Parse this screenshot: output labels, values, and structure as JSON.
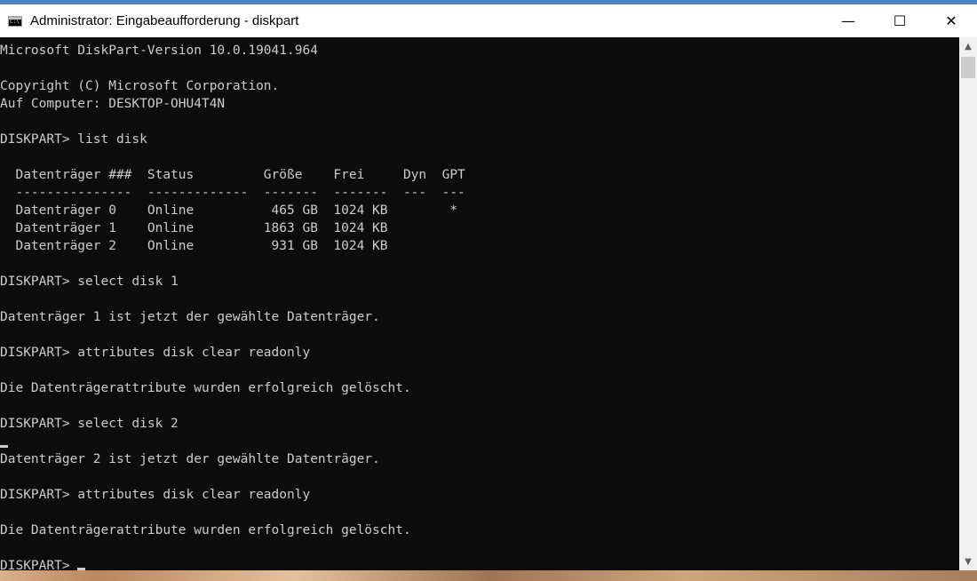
{
  "window": {
    "title": "Administrator: Eingabeaufforderung - diskpart",
    "minimize_symbol": "—",
    "maximize_symbol": "☐",
    "close_symbol": "✕"
  },
  "console": {
    "lines": [
      "Microsoft DiskPart-Version 10.0.19041.964",
      "",
      "Copyright (C) Microsoft Corporation.",
      "Auf Computer: DESKTOP-OHU4T4N",
      "",
      "DISKPART> list disk",
      "",
      "  Datenträger ###  Status         Größe    Frei     Dyn  GPT",
      "  ---------------  -------------  -------  -------  ---  ---",
      "  Datenträger 0    Online          465 GB  1024 KB        *",
      "  Datenträger 1    Online         1863 GB  1024 KB",
      "  Datenträger 2    Online          931 GB  1024 KB",
      "",
      "DISKPART> select disk 1",
      "",
      "Datenträger 1 ist jetzt der gewählte Datenträger.",
      "",
      "DISKPART> attributes disk clear readonly",
      "",
      "Die Datenträgerattribute wurden erfolgreich gelöscht.",
      "",
      "DISKPART> select disk 2",
      "",
      "Datenträger 2 ist jetzt der gewählte Datenträger.",
      "",
      "DISKPART> attributes disk clear readonly",
      "",
      "Die Datenträgerattribute wurden erfolgreich gelöscht.",
      "",
      "DISKPART> "
    ]
  },
  "scrollbar": {
    "up_arrow": "▲",
    "down_arrow": "▼"
  },
  "colors": {
    "console_bg": "#0c0c0c",
    "console_text": "#cccccc",
    "titlebar_bg": "#ffffff",
    "accent_border": "#4a86c8"
  }
}
